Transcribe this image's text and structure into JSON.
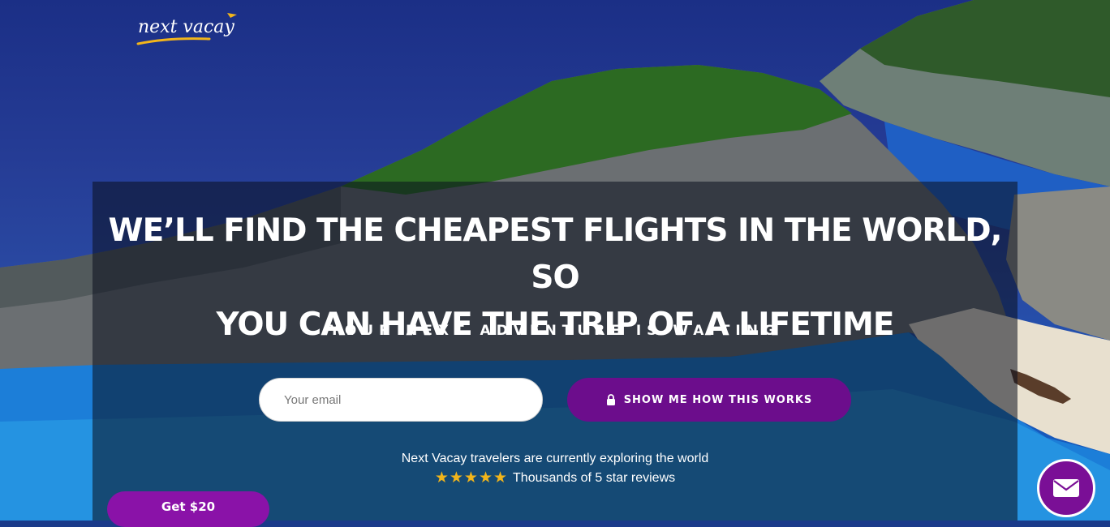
{
  "brand": {
    "logo_text": "next vacay"
  },
  "hero": {
    "headline_line1": "WE’LL FIND THE CHEAPEST FLIGHTS IN THE WORLD, SO",
    "headline_line2": "YOU CAN HAVE THE TRIP OF A LIFETIME",
    "subheadline": "YOUR NEXT ADVENTURE IS WAITING"
  },
  "form": {
    "email_placeholder": "Your email",
    "email_value": "",
    "cta_label": "SHOW ME HOW THIS WORKS",
    "cta_icon": "lock-icon"
  },
  "social_proof": {
    "exploring_text": "Next Vacay travelers are currently exploring the world",
    "star_count": 5,
    "stars": "★★★★★",
    "reviews_text": "Thousands of 5 star reviews"
  },
  "referral": {
    "label": "Get $20"
  },
  "chat": {
    "icon": "mail-icon"
  },
  "colors": {
    "primary_purple": "#6c0d8c",
    "referral_purple": "#8a12a8",
    "star_gold": "#f2b51b",
    "logo_gold": "#f2b51b"
  }
}
